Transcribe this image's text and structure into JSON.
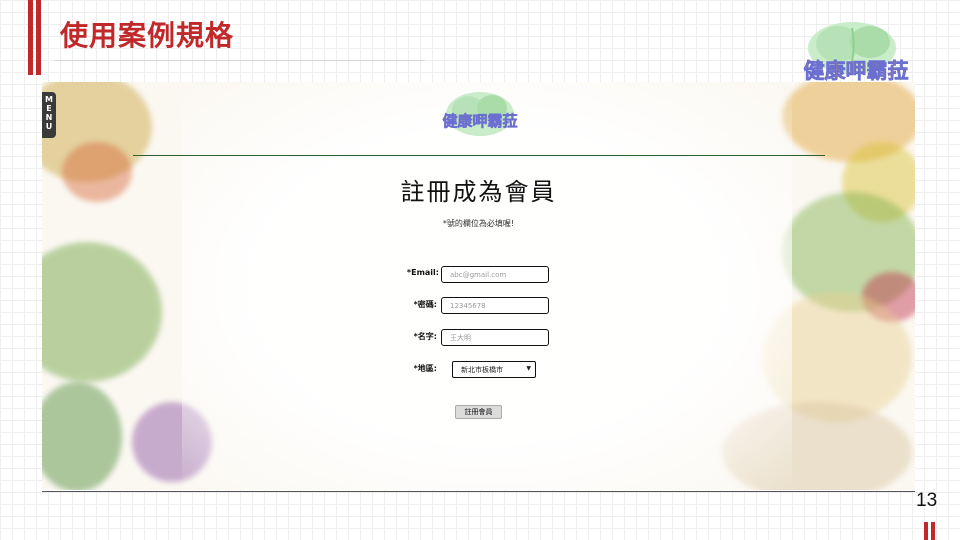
{
  "slide": {
    "title": "使用案例規格",
    "page_number": "13",
    "accent_color": "#c0282a"
  },
  "logo": {
    "text": "健康呷霸菈",
    "icon": "cabbage-logo-icon"
  },
  "app": {
    "menu_label": "MENU",
    "heading": "註冊成為會員",
    "required_note": "*號的欄位為必填喔!",
    "fields": {
      "email": {
        "label": "*Email:",
        "placeholder": "abc@gmail.com"
      },
      "password": {
        "label": "*密碼:",
        "placeholder": "12345678"
      },
      "name": {
        "label": "*名字:",
        "placeholder": "王大明"
      },
      "region": {
        "label": "*地區:",
        "selected": "新北市板橋市",
        "icon": "chevron-down-icon"
      }
    },
    "submit_label": "註冊會員",
    "rule_color": "#2f5e2f"
  }
}
